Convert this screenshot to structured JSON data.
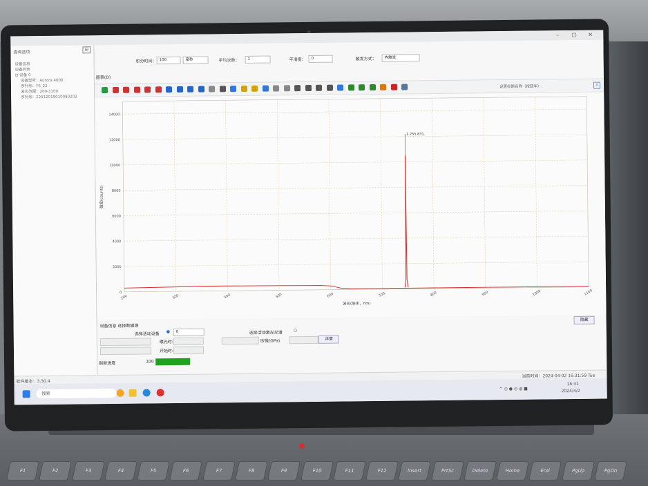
{
  "window": {
    "title": "",
    "minimize": "–",
    "maximize": "▢",
    "close": "✕"
  },
  "left_panel": {
    "tab": "查询选项",
    "collapse_btn": "⊟",
    "lines": [
      "设备信息",
      "设备列表",
      "⊟ 设备 0",
      "设备型号：Aurora 4000",
      "序列号：YS_22",
      "波长范围：200-1100",
      "序列号：22512019010080202"
    ]
  },
  "params": {
    "integration_label": "积分时间：",
    "integration_value": "100",
    "unit_value": "毫秒",
    "avg_label": "平均次数：",
    "avg_value": "1",
    "smooth_label": "平滑度：",
    "smooth_value": "0",
    "trigger_label": "触发方式：",
    "trigger_value": "内触发"
  },
  "tab_label": "图表(D)",
  "toolbar": {
    "right_text": "设置标题名称（按回车）:",
    "close": "✕",
    "icons": [
      "play-icon",
      "pause-icon",
      "step-icon",
      "crosshair-icon",
      "grid-icon",
      "box-icon",
      "zoom-in-icon",
      "zoom-out-icon",
      "zoom-x-icon",
      "zoom-y-icon",
      "pan-icon",
      "cursor-icon",
      "peak-icon",
      "bulb-icon",
      "light-icon",
      "s-icon",
      "mark-icon",
      "ruler-icon",
      "cal-icon",
      "integral-icon",
      "diff-icon",
      "l-icon",
      "a-icon",
      "bar1-icon",
      "bar2-icon",
      "bar3-icon",
      "img-icon",
      "red-icon",
      "save-icon"
    ]
  },
  "chart_data": {
    "type": "line",
    "ylabel": "强度(counts)",
    "xlabel": "波长(纳米，nm)",
    "ylim": [
      0,
      15000
    ],
    "y_ticks": [
      "0",
      "2000",
      "4000",
      "6000",
      "8000",
      "10000",
      "12000",
      "14000"
    ],
    "x_ticks": [
      "200",
      "300",
      "400",
      "500",
      "600",
      "700",
      "800",
      "900",
      "1000",
      "1100"
    ],
    "xlim": [
      200,
      1100
    ],
    "peak_label": "1.755 831",
    "series": [
      {
        "color": "#d62828",
        "x": [
          200,
          250,
          300,
          350,
          400,
          450,
          500,
          550,
          580,
          600,
          620,
          640,
          680,
          700,
          720,
          750,
          800,
          850,
          900,
          950,
          1000,
          1050,
          1100
        ],
        "y": [
          300,
          320,
          350,
          380,
          380,
          370,
          360,
          350,
          340,
          300,
          120,
          60,
          60,
          60,
          60,
          60,
          60,
          60,
          60,
          60,
          60,
          60,
          60
        ]
      }
    ],
    "peak_series": {
      "x": [
        744,
        746,
        747,
        748,
        750
      ],
      "y": [
        120,
        800,
        10500,
        800,
        120
      ]
    }
  },
  "side_button": "隐藏",
  "status": {
    "section_label": "设备信息 选择数据源",
    "select_device_label": "选择活动设备",
    "device_value": "0",
    "select_channel_label": "选择活动激光光谱",
    "exposure_label": "曝光时:",
    "start_label": "开始时:",
    "pressure_label": "压强(GPa)",
    "detail_btn": "详情",
    "progress_label": "刷新进度",
    "progress_value": "100",
    "progress_fraction": 1.0
  },
  "bottom_status": {
    "left": "软件版本：3.30.4",
    "right": "当前时间：2024-04-02 16:31:59 Tue"
  },
  "taskbar": {
    "search_placeholder": "搜索",
    "time": "16:31",
    "date": "2024/4/2"
  },
  "keyboard": [
    "F1",
    "F2",
    "F3",
    "F4",
    "F5",
    "F6",
    "F7",
    "F8",
    "F9",
    "F10",
    "F11",
    "F12",
    "Insert",
    "PrtSc",
    "Delete",
    "Home",
    "End",
    "PgUp",
    "PgDn"
  ],
  "colors": {
    "accent": "#1fa21f",
    "plot": "#d62828",
    "grid": "#d8c88a"
  }
}
